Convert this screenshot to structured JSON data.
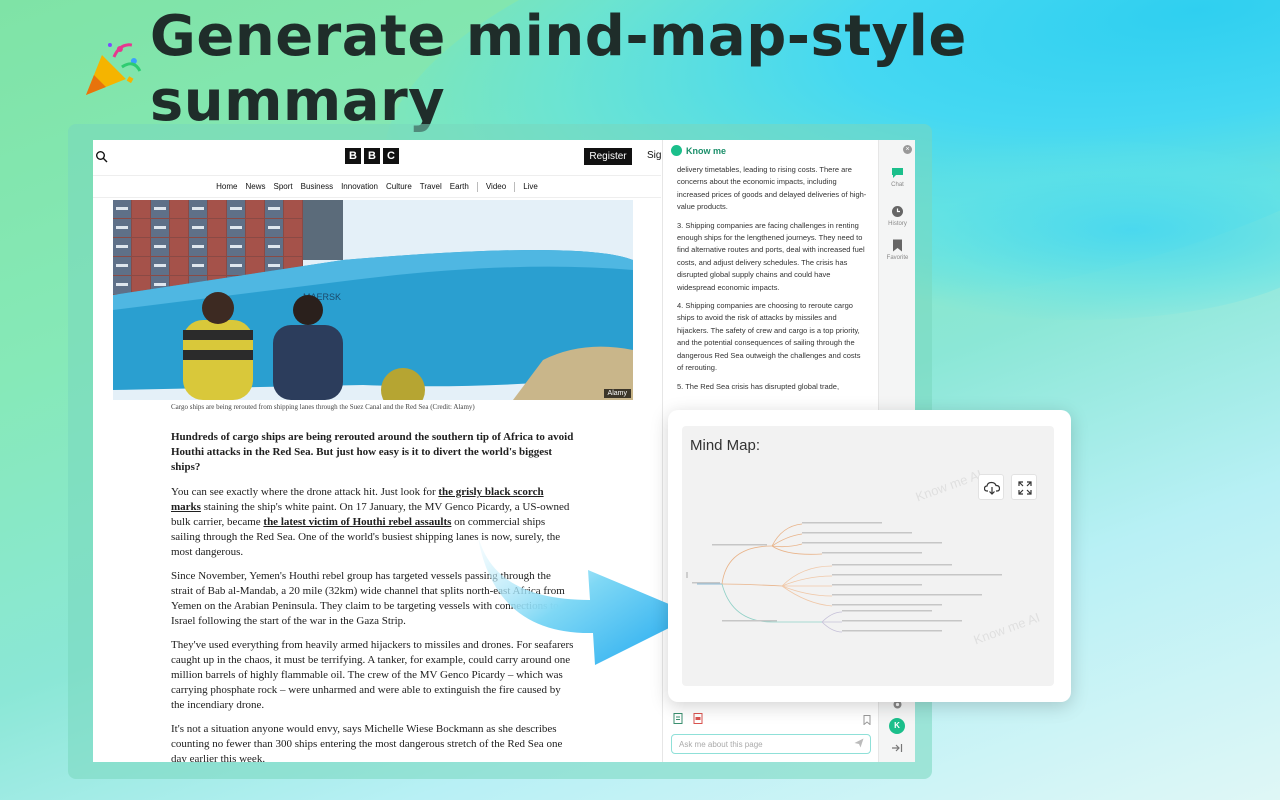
{
  "headline": {
    "text": "Generate mind-map-style summary"
  },
  "bbc": {
    "logo": [
      "B",
      "B",
      "C"
    ],
    "register_label": "Register",
    "signin_label": "Sig",
    "nav": [
      "Home",
      "News",
      "Sport",
      "Business",
      "Innovation",
      "Culture",
      "Travel",
      "Earth",
      "Video",
      "Live"
    ],
    "hero_credit": "Alamy",
    "ship_name": "MAERSK",
    "caption": "Cargo ships are being rerouted from shipping lanes through the Suez Canal and the Red Sea (Credit: Alamy)",
    "lead": "Hundreds of cargo ships are being rerouted around the southern tip of Africa to avoid Houthi attacks in the Red Sea. But just how easy is it to divert the world's biggest ships?",
    "p1_a": "You can see exactly where the drone attack hit. Just look for ",
    "p1_link1": "the grisly black scorch marks",
    "p1_b": " staining the ship's white paint. On 17 January, the MV Genco Picardy, a US-owned bulk carrier, became ",
    "p1_link2": "the latest victim of Houthi rebel assaults",
    "p1_c": " on commercial ships sailing through the Red Sea. One of the world's busiest shipping lanes is now, surely, the most dangerous.",
    "p2": "Since November, Yemen's Houthi rebel group has targeted vessels passing through the strait of Bab al-Mandab, a 20 mile (32km) wide channel that splits north-east Africa from Yemen on the Arabian Peninsula. They claim to be targeting vessels with connections to Israel following the start of the war in the Gaza Strip.",
    "p3": "They've used everything from heavily armed hijackers to missiles and drones. For seafarers caught up in the chaos, it must be terrifying. A tanker, for example, could carry around one million barrels of highly flammable oil. The crew of the MV Genco Picardy – which was carrying phosphate rock – were unharmed and were able to extinguish the fire caused by the incendiary drone.",
    "p4": "It's not a situation anyone would envy, says Michelle Wiese Bockmann as she describes counting no fewer than 300 ships entering the most dangerous stretch of the Red Sea one day earlier this week."
  },
  "panel": {
    "title": "Know me",
    "para_top": "delivery timetables, leading to rising costs. There are concerns about the economic impacts, including increased prices of goods and delayed deliveries of high-value products.",
    "para3": "3. Shipping companies are facing challenges in renting enough ships for the lengthened journeys. They need to find alternative routes and ports, deal with increased fuel costs, and adjust delivery schedules. The crisis has disrupted global supply chains and could have widespread economic impacts.",
    "para4": "4. Shipping companies are choosing to reroute cargo ships to avoid the risk of attacks by missiles and hijackers. The safety of crew and cargo is a top priority, and the potential consequences of sailing through the dangerous Red Sea outweigh the challenges and costs of rerouting.",
    "para5": "5. The Red Sea crisis has disrupted global trade,",
    "input_placeholder": "Ask me about this page"
  },
  "rail": {
    "items": [
      "Chat",
      "History",
      "Favorite"
    ],
    "avatar": "K"
  },
  "mindmap": {
    "title": "Mind Map:",
    "watermark": "Know me AI"
  },
  "colors": {
    "accent": "#1bbf8b",
    "brand_dark": "#1f2d2a",
    "branch_orange": "#e9b48a",
    "branch_blue": "#9cc3dd",
    "branch_teal": "#8fd0c6"
  }
}
